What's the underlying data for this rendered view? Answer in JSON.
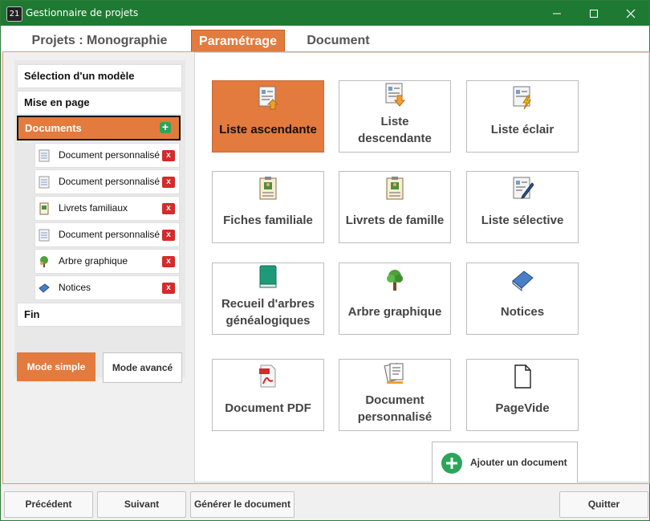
{
  "window": {
    "title": "Gestionnaire de projets",
    "icon_text": "21"
  },
  "tabs": [
    {
      "label": "Projets : Monographie"
    },
    {
      "label": "Paramétrage"
    },
    {
      "label": "Document"
    }
  ],
  "sidebar": {
    "items": [
      {
        "label": "Sélection d'un modèle"
      },
      {
        "label": "Mise en page"
      },
      {
        "label": "Documents"
      },
      {
        "label": "Fin"
      }
    ],
    "documents": [
      {
        "label": "Document personnalisé",
        "icon": "document-icon"
      },
      {
        "label": "Document personnalisé",
        "icon": "document-icon"
      },
      {
        "label": "Livrets familiaux",
        "icon": "booklet-icon"
      },
      {
        "label": "Document personnalisé",
        "icon": "document-icon"
      },
      {
        "label": "Arbre graphique",
        "icon": "tree-icon"
      },
      {
        "label": "Notices",
        "icon": "book-icon"
      }
    ],
    "mode_simple": "Mode simple",
    "mode_avance": "Mode avancé"
  },
  "cards": [
    {
      "label1": "Liste ascendante",
      "label2": "",
      "icon": "list-up-icon"
    },
    {
      "label1": "Liste",
      "label2": "descendante",
      "icon": "list-down-icon"
    },
    {
      "label1": "Liste éclair",
      "label2": "",
      "icon": "list-flash-icon"
    },
    {
      "label1": "Fiches familiale",
      "label2": "",
      "icon": "family-sheet-icon"
    },
    {
      "label1": "Livrets de famille",
      "label2": "",
      "icon": "family-booklet-icon"
    },
    {
      "label1": "Liste sélective",
      "label2": "",
      "icon": "selective-list-icon"
    },
    {
      "label1": "Recueil d'arbres",
      "label2": "généalogiques",
      "icon": "green-book-icon"
    },
    {
      "label1": "Arbre graphique",
      "label2": "",
      "icon": "tree-icon"
    },
    {
      "label1": "Notices",
      "label2": "",
      "icon": "blue-book-icon"
    },
    {
      "label1": "Document PDF",
      "label2": "",
      "icon": "pdf-icon"
    },
    {
      "label1": "Document",
      "label2": "personnalisé",
      "icon": "custom-doc-icon"
    },
    {
      "label1": "PageVide",
      "label2": "",
      "icon": "blank-page-icon"
    }
  ],
  "add_document": "Ajouter un document",
  "footer": {
    "precedent": "Précédent",
    "suivant": "Suivant",
    "generer": "Générer le document",
    "quitter": "Quitter"
  },
  "colors": {
    "accent": "#e37a3e",
    "titlebar": "#1e7a32",
    "add": "#2ca55a",
    "delete": "#d42b2b"
  }
}
